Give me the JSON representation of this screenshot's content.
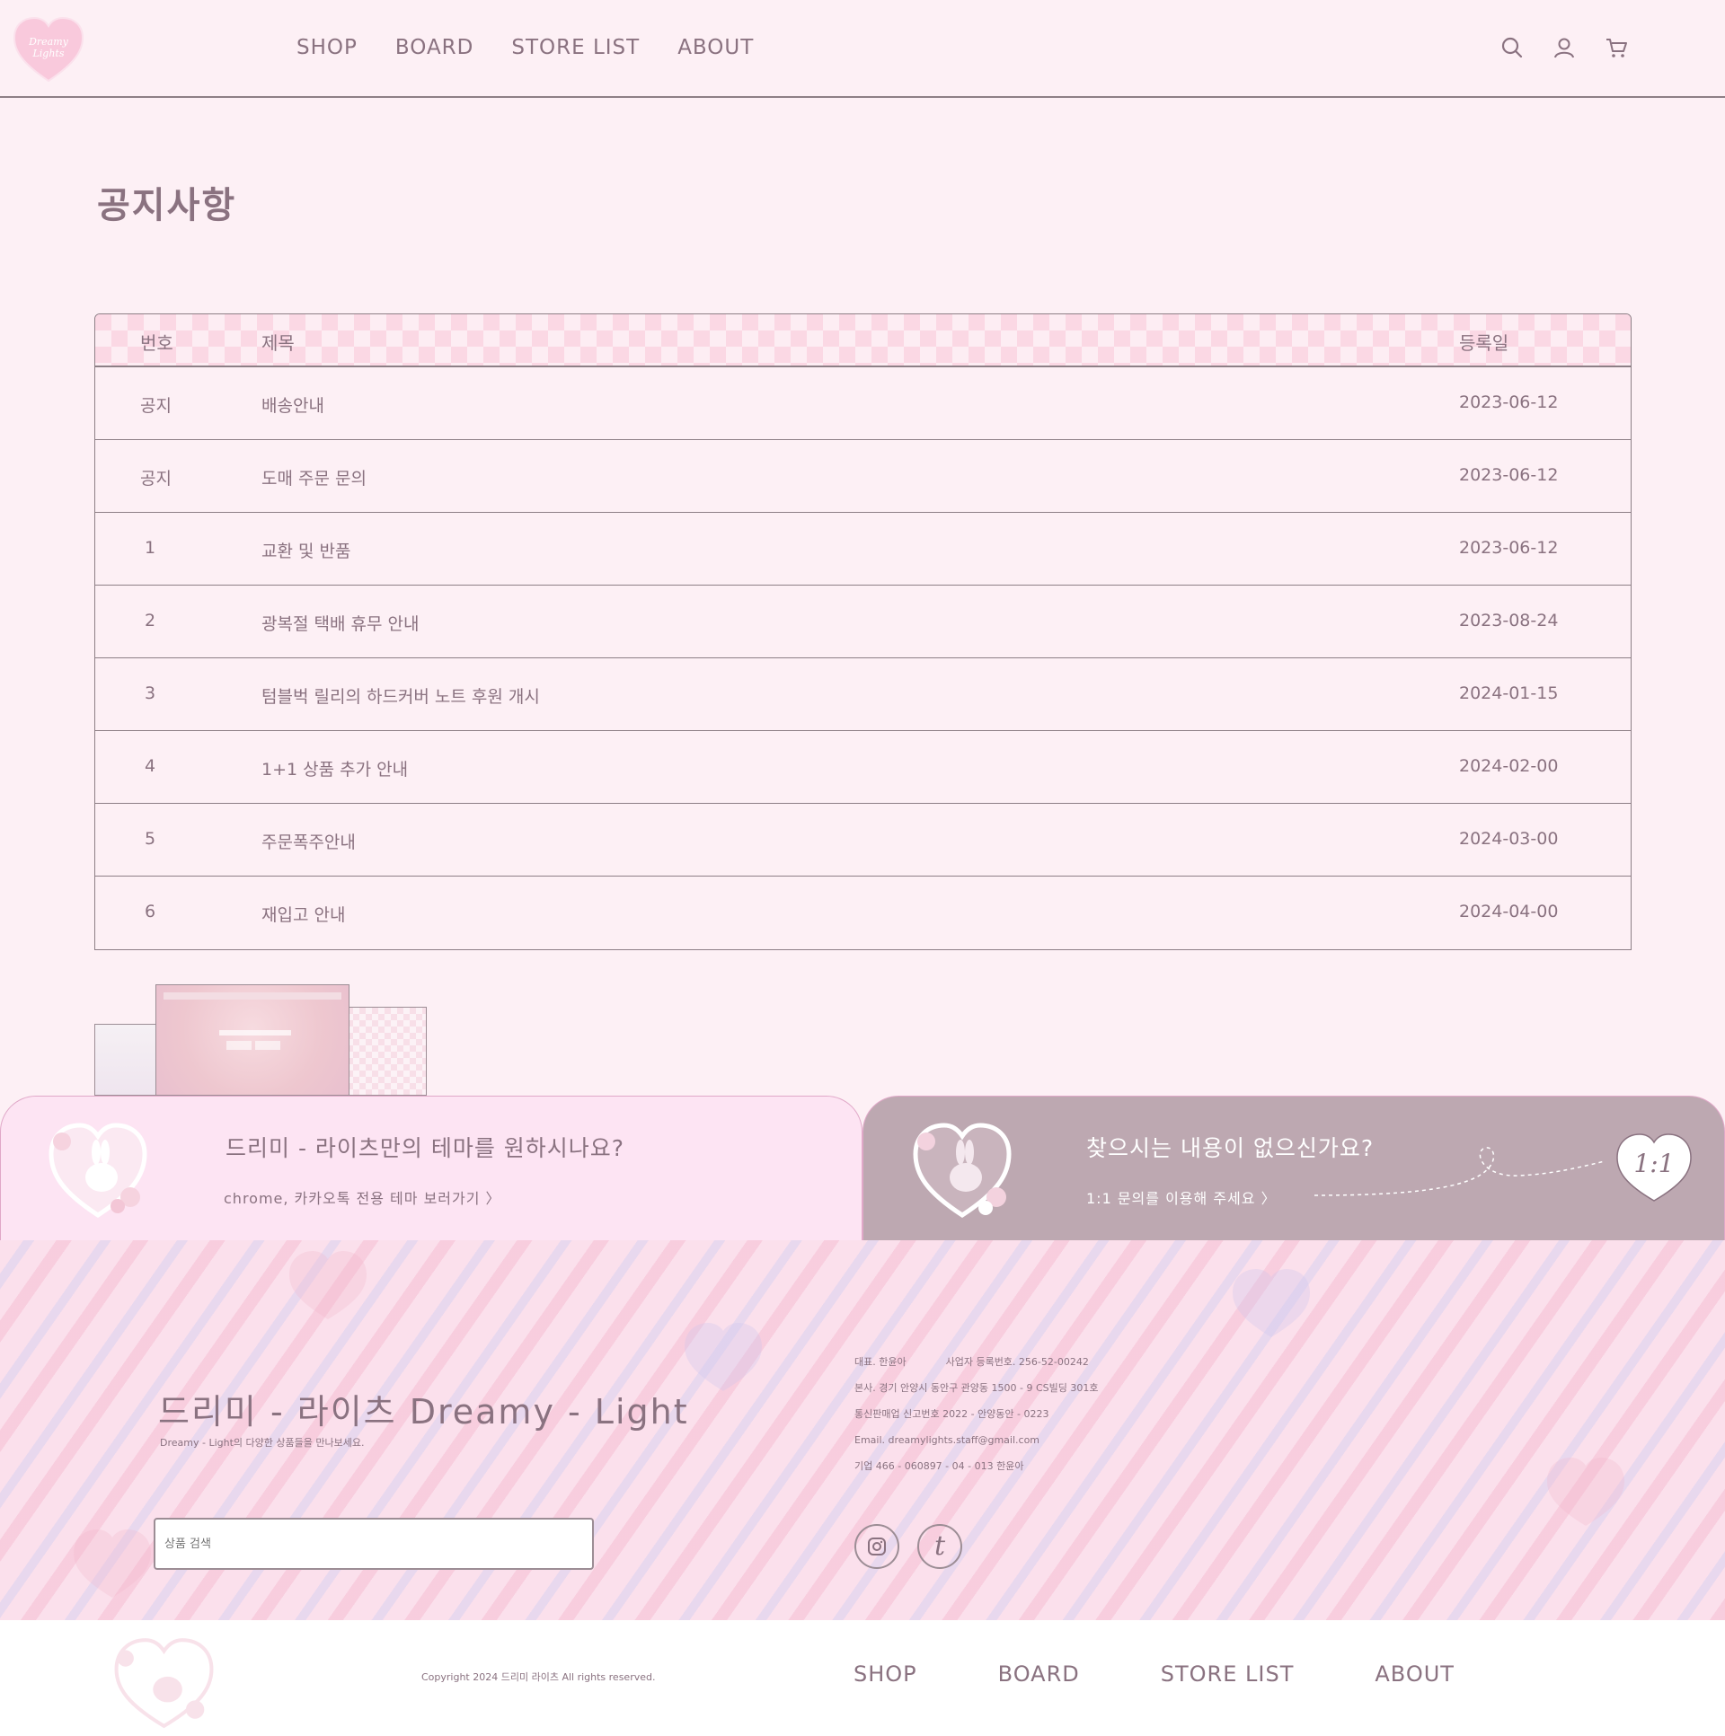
{
  "header": {
    "logo_text": "Dreamy Lights",
    "nav": [
      "SHOP",
      "BOARD",
      "STORE LIST",
      "ABOUT"
    ],
    "icons": [
      "search-icon",
      "user-icon",
      "cart-icon"
    ]
  },
  "page_title": "공지사항",
  "table": {
    "headers": {
      "num": "번호",
      "title": "제목",
      "date": "등록일"
    },
    "rows": [
      {
        "num": "공지",
        "title": "배송안내",
        "date": "2023-06-12"
      },
      {
        "num": "공지",
        "title": "도매 주문 문의",
        "date": "2023-06-12"
      },
      {
        "num": "1",
        "title": "교환 및 반품",
        "date": "2023-06-12"
      },
      {
        "num": "2",
        "title": "광복절 택배 휴무 안내",
        "date": "2023-08-24"
      },
      {
        "num": "3",
        "title": "텀블벅 릴리의 하드커버 노트 후원 개시",
        "date": "2024-01-15"
      },
      {
        "num": "4",
        "title": "1+1 상품 추가 안내",
        "date": "2024-02-00"
      },
      {
        "num": "5",
        "title": "주문폭주안내",
        "date": "2024-03-00"
      },
      {
        "num": "6",
        "title": "재입고 안내",
        "date": "2024-04-00"
      }
    ]
  },
  "banners": {
    "left": {
      "title": "드리미 - 라이츠만의 테마를 원하시나요?",
      "link": "chrome, 카카오톡 전용 테마 보러가기 〉"
    },
    "right": {
      "title": "찾으시는 내용이 없으신가요?",
      "link": "1:1 문의를 이용해 주세요 〉",
      "badge": "1:1"
    }
  },
  "footer": {
    "brand": "드리미 - 라이츠 Dreamy - Light",
    "brand_sub": "Dreamy - Light의 다양한 상품들을 만나보세요.",
    "search_placeholder": "상품 검색",
    "info": {
      "ceo": "대표. 한윤아",
      "biz_no": "사업자 등록번호. 256-52-00242",
      "address": "본사. 경기 안양시 동안구 관양동 1500 - 9 CS빌딩 301호",
      "ecommerce": "통신판매업 신고번호 2022 - 안양동안 - 0223",
      "email": "Email. dreamylights.staff@gmail.com",
      "company": "기업 466 - 060897 - 04 - 013 한윤아"
    },
    "social": [
      "instagram-icon",
      "tumblr-icon"
    ],
    "tumblr_letter": "t"
  },
  "bottom": {
    "copyright": "Copyright 2024 드리미 라이츠 All rights reserved.",
    "nav": [
      "SHOP",
      "BOARD",
      "STORE LIST",
      "ABOUT"
    ]
  },
  "colors": {
    "background": "#fdf0f5",
    "text": "#8a7280",
    "table_header": "#fbd8e4",
    "banner_left": "#fde4f3",
    "banner_right": "#bda8b1",
    "accent_pink": "#f6c1d6"
  }
}
